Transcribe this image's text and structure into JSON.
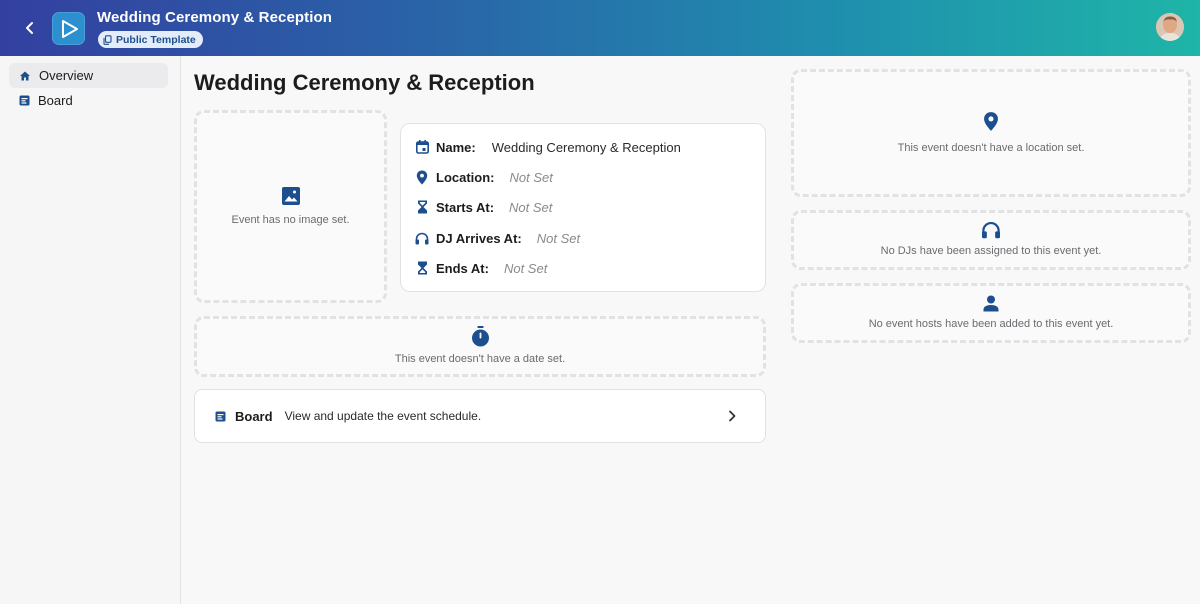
{
  "header": {
    "title": "Wedding Ceremony & Reception",
    "badge": "Public Template",
    "gradient": [
      "#3340a0",
      "#1fb5a8"
    ]
  },
  "sidebar": {
    "items": [
      {
        "label": "Overview",
        "icon": "home-icon",
        "active": true
      },
      {
        "label": "Board",
        "icon": "board-icon",
        "active": false
      }
    ]
  },
  "main": {
    "title": "Wedding Ceremony & Reception",
    "image_empty": "Event has no image set.",
    "details": {
      "name_label": "Name:",
      "name_value": "Wedding Ceremony & Reception",
      "location_label": "Location:",
      "location_value": "Not Set",
      "starts_label": "Starts At:",
      "starts_value": "Not Set",
      "dj_label": "DJ Arrives At:",
      "dj_value": "Not Set",
      "ends_label": "Ends At:",
      "ends_value": "Not Set"
    },
    "date_empty": "This event doesn't have a date set.",
    "board": {
      "title": "Board",
      "description": "View and update the event schedule."
    }
  },
  "right_panel": {
    "location_empty": "This event doesn't have a location set.",
    "djs_empty": "No DJs have been assigned to this event yet.",
    "hosts_empty": "No event hosts have been added to this event yet."
  },
  "colors": {
    "icon_accent": "#1d4f8f",
    "badge_bg": "#e3ecf8"
  }
}
